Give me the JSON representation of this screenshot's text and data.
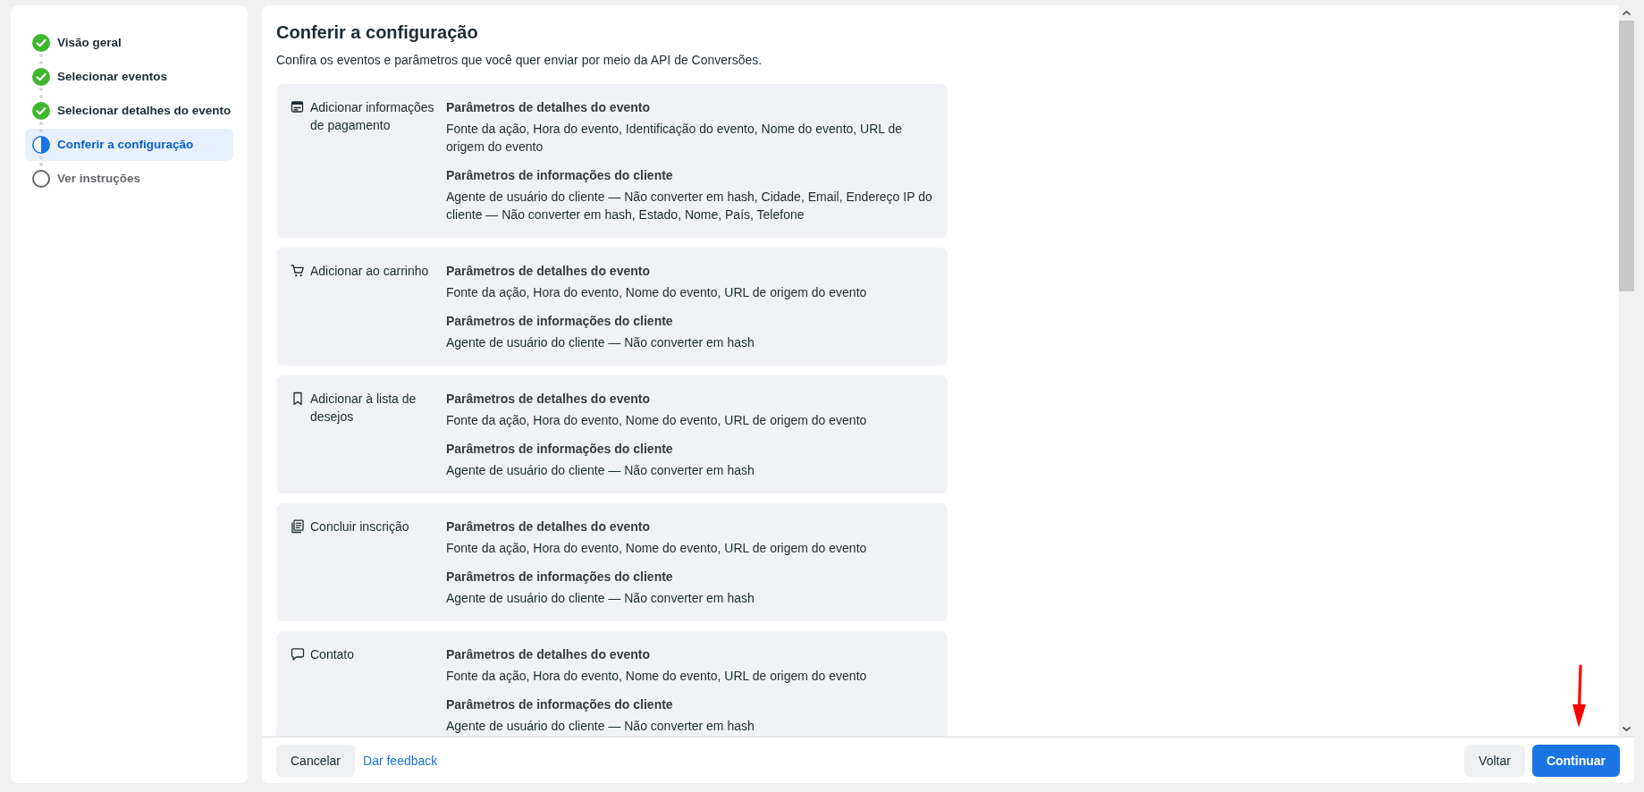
{
  "sidebar": {
    "steps": [
      {
        "label": "Visão geral",
        "kind": "done",
        "selected": false
      },
      {
        "label": "Selecionar eventos",
        "kind": "done",
        "selected": false
      },
      {
        "label": "Selecionar detalhes do evento",
        "kind": "done",
        "selected": false
      },
      {
        "label": "Conferir a configuração",
        "kind": "current",
        "selected": true
      },
      {
        "label": "Ver instruções",
        "kind": "pending",
        "selected": false
      }
    ]
  },
  "main": {
    "title": "Conferir a configuração",
    "description": "Confira os eventos e parâmetros que você quer enviar por meio da API de Conversões.",
    "events": [
      {
        "name": "Adicionar informações de pagamento",
        "sections": [
          {
            "heading": "Parâmetros de detalhes do evento",
            "text": "Fonte da ação, Hora do evento, Identificação do evento, Nome do evento, URL de origem do evento"
          },
          {
            "heading": "Parâmetros de informações do cliente",
            "text": "Agente de usuário do cliente — Não converter em hash, Cidade, Email, Endereço IP do cliente — Não converter em hash, Estado, Nome, País, Telefone"
          }
        ]
      },
      {
        "name": "Adicionar ao carrinho",
        "sections": [
          {
            "heading": "Parâmetros de detalhes do evento",
            "text": "Fonte da ação, Hora do evento, Nome do evento, URL de origem do evento"
          },
          {
            "heading": "Parâmetros de informações do cliente",
            "text": "Agente de usuário do cliente — Não converter em hash"
          }
        ]
      },
      {
        "name": "Adicionar à lista de desejos",
        "sections": [
          {
            "heading": "Parâmetros de detalhes do evento",
            "text": "Fonte da ação, Hora do evento, Nome do evento, URL de origem do evento"
          },
          {
            "heading": "Parâmetros de informações do cliente",
            "text": "Agente de usuário do cliente — Não converter em hash"
          }
        ]
      },
      {
        "name": "Concluir inscrição",
        "sections": [
          {
            "heading": "Parâmetros de detalhes do evento",
            "text": "Fonte da ação, Hora do evento, Nome do evento, URL de origem do evento"
          },
          {
            "heading": "Parâmetros de informações do cliente",
            "text": "Agente de usuário do cliente — Não converter em hash"
          }
        ]
      },
      {
        "name": "Contato",
        "sections": [
          {
            "heading": "Parâmetros de detalhes do evento",
            "text": "Fonte da ação, Hora do evento, Nome do evento, URL de origem do evento"
          },
          {
            "heading": "Parâmetros de informações do cliente",
            "text": "Agente de usuário do cliente — Não converter em hash"
          }
        ]
      }
    ]
  },
  "footer": {
    "left": [
      {
        "label": "Cancelar",
        "kind": "secondary"
      },
      {
        "label": "Dar feedback",
        "kind": "link"
      }
    ],
    "right": [
      {
        "label": "Voltar",
        "kind": "secondary"
      },
      {
        "label": "Continuar",
        "kind": "primary"
      }
    ]
  }
}
